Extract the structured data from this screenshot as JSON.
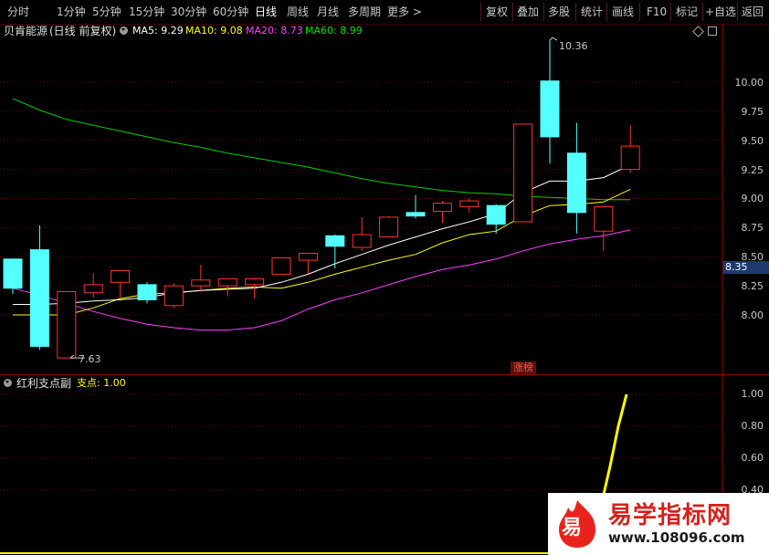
{
  "toolbar": {
    "periods": [
      "分时",
      "1分钟",
      "5分钟",
      "15分钟",
      "30分钟",
      "60分钟",
      "日线",
      "周线",
      "月线",
      "多周期",
      "更多 >"
    ],
    "active_period": "日线",
    "actions": [
      "复权",
      "叠加",
      "多股",
      "统计",
      "画线",
      "F10",
      "标记",
      "+自选",
      "返回"
    ]
  },
  "main_chart": {
    "stock_name": "贝肯能源",
    "mode": "(日线 前复权)",
    "ma": [
      {
        "label": "MA5: 9.29",
        "color": "#ffffff"
      },
      {
        "label": "MA10: 9.08",
        "color": "#ffff00"
      },
      {
        "label": "MA20: 8.73",
        "color": "#ff40ff"
      },
      {
        "label": "MA60: 8.99",
        "color": "#00e000"
      }
    ],
    "y_ticks": [
      "10.00",
      "9.75",
      "9.50",
      "9.25",
      "9.00",
      "8.75",
      "8.50",
      "8.25",
      "8.00"
    ],
    "current_price": "8.35",
    "high_label": "10.36",
    "low_label": "7.63",
    "badge": "涨榜"
  },
  "sub_chart": {
    "indicator_name": "红利支点副",
    "line_label": "支点: 1.00",
    "y_ticks": [
      "1.00",
      "0.80",
      "0.60",
      "0.40"
    ]
  },
  "chart_data": {
    "type": "candlestick",
    "candles": [
      {
        "o": 8.48,
        "h": 8.48,
        "l": 8.18,
        "c": 8.23
      },
      {
        "o": 8.56,
        "h": 8.77,
        "l": 7.7,
        "c": 7.73
      },
      {
        "o": 7.63,
        "h": 8.2,
        "l": 7.63,
        "c": 8.2
      },
      {
        "o": 8.19,
        "h": 8.36,
        "l": 8.15,
        "c": 8.26
      },
      {
        "o": 8.28,
        "h": 8.38,
        "l": 8.14,
        "c": 8.38
      },
      {
        "o": 8.26,
        "h": 8.28,
        "l": 8.1,
        "c": 8.13
      },
      {
        "o": 8.08,
        "h": 8.27,
        "l": 8.06,
        "c": 8.25
      },
      {
        "o": 8.25,
        "h": 8.43,
        "l": 8.2,
        "c": 8.3
      },
      {
        "o": 8.25,
        "h": 8.31,
        "l": 8.16,
        "c": 8.31
      },
      {
        "o": 8.26,
        "h": 8.32,
        "l": 8.14,
        "c": 8.31
      },
      {
        "o": 8.35,
        "h": 8.49,
        "l": 8.35,
        "c": 8.49
      },
      {
        "o": 8.47,
        "h": 8.53,
        "l": 8.35,
        "c": 8.53
      },
      {
        "o": 8.68,
        "h": 8.69,
        "l": 8.4,
        "c": 8.59
      },
      {
        "o": 8.58,
        "h": 8.84,
        "l": 8.55,
        "c": 8.69
      },
      {
        "o": 8.67,
        "h": 8.85,
        "l": 8.67,
        "c": 8.84
      },
      {
        "o": 8.88,
        "h": 9.03,
        "l": 8.83,
        "c": 8.85
      },
      {
        "o": 8.89,
        "h": 8.98,
        "l": 8.79,
        "c": 8.96
      },
      {
        "o": 8.93,
        "h": 9.0,
        "l": 8.88,
        "c": 8.98
      },
      {
        "o": 8.94,
        "h": 8.95,
        "l": 8.7,
        "c": 8.78
      },
      {
        "o": 8.8,
        "h": 9.64,
        "l": 8.8,
        "c": 9.64
      },
      {
        "o": 10.01,
        "h": 10.36,
        "l": 9.3,
        "c": 9.53
      },
      {
        "o": 9.39,
        "h": 9.65,
        "l": 8.7,
        "c": 8.88
      },
      {
        "o": 8.72,
        "h": 8.92,
        "l": 8.55,
        "c": 8.93
      },
      {
        "o": 9.25,
        "h": 9.63,
        "l": 9.22,
        "c": 9.45
      }
    ],
    "ma5": [
      8.09,
      8.09,
      8.1,
      8.12,
      8.13,
      8.15,
      8.19,
      8.21,
      8.22,
      8.23,
      8.28,
      8.35,
      8.44,
      8.52,
      8.6,
      8.67,
      8.74,
      8.8,
      8.87,
      9.05,
      9.15,
      9.15,
      9.18,
      9.29
    ],
    "ma10": [
      8.0,
      8.0,
      8.0,
      8.06,
      8.14,
      8.18,
      8.19,
      8.21,
      8.23,
      8.24,
      8.23,
      8.28,
      8.35,
      8.41,
      8.47,
      8.52,
      8.62,
      8.69,
      8.72,
      8.85,
      8.94,
      8.95,
      8.97,
      9.08
    ],
    "ma20": [
      8.23,
      8.17,
      8.1,
      8.03,
      7.97,
      7.92,
      7.89,
      7.87,
      7.87,
      7.89,
      7.95,
      8.05,
      8.13,
      8.19,
      8.26,
      8.33,
      8.39,
      8.43,
      8.48,
      8.55,
      8.61,
      8.65,
      8.68,
      8.73
    ],
    "ma60": [
      9.86,
      9.76,
      9.68,
      9.63,
      9.58,
      9.53,
      9.48,
      9.44,
      9.39,
      9.35,
      9.31,
      9.27,
      9.22,
      9.17,
      9.13,
      9.1,
      9.07,
      9.05,
      9.04,
      9.02,
      9.01,
      9.0,
      8.99,
      8.99
    ],
    "ylim": [
      7.55,
      10.45
    ],
    "sub_series": {
      "name": "支点",
      "values": [
        0.2,
        0.35,
        0.55,
        0.8,
        1.0
      ]
    },
    "sub_ylim": [
      0.25,
      1.05
    ]
  },
  "watermark": {
    "logo_char": "易",
    "title": "易学指标网",
    "url": "www.108096.com"
  }
}
